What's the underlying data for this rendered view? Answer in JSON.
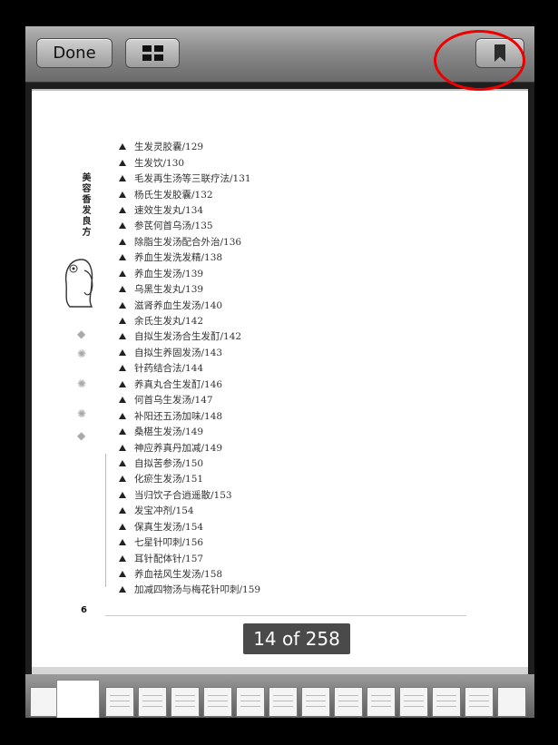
{
  "toolbar": {
    "done_label": "Done",
    "grid_icon": "grid-icon",
    "bookmark_icon": "bookmark-icon"
  },
  "page": {
    "side_title": "美容香发良方",
    "toc": [
      "生发灵胶囊/129",
      "生发饮/130",
      "毛发再生汤等三联疗法/131",
      "杨氏生发胶囊/132",
      "速效生发丸/134",
      "参芪何首乌汤/135",
      "除脂生发汤配合外治/136",
      "养血生发洗发精/138",
      "养血生发汤/139",
      "乌黑生发丸/139",
      "滋肾养血生发汤/140",
      "余氏生发丸/142",
      "自拟生发汤合生发酊/142",
      "自拟生养固发汤/143",
      "针药结合法/144",
      "养真丸合生发酊/146",
      "何首乌生发汤/147",
      "补阳还五汤加味/148",
      "桑椹生发汤/149",
      "神应养真丹加减/149",
      "自拟苦参汤/150",
      "化瘀生发汤/151",
      "当归饮子合逍遥散/153",
      "发宝冲剂/154",
      "保真生发汤/154",
      "七星针叩刺/156",
      "耳针配体针/157",
      "养血祛风生发汤/158",
      "加减四物汤与梅花针叩刺/159"
    ],
    "page_number": "6"
  },
  "page_counter": "14 of 258",
  "colors": {
    "annotation": "#e00000",
    "counter_bg": "#4a4a4a"
  }
}
